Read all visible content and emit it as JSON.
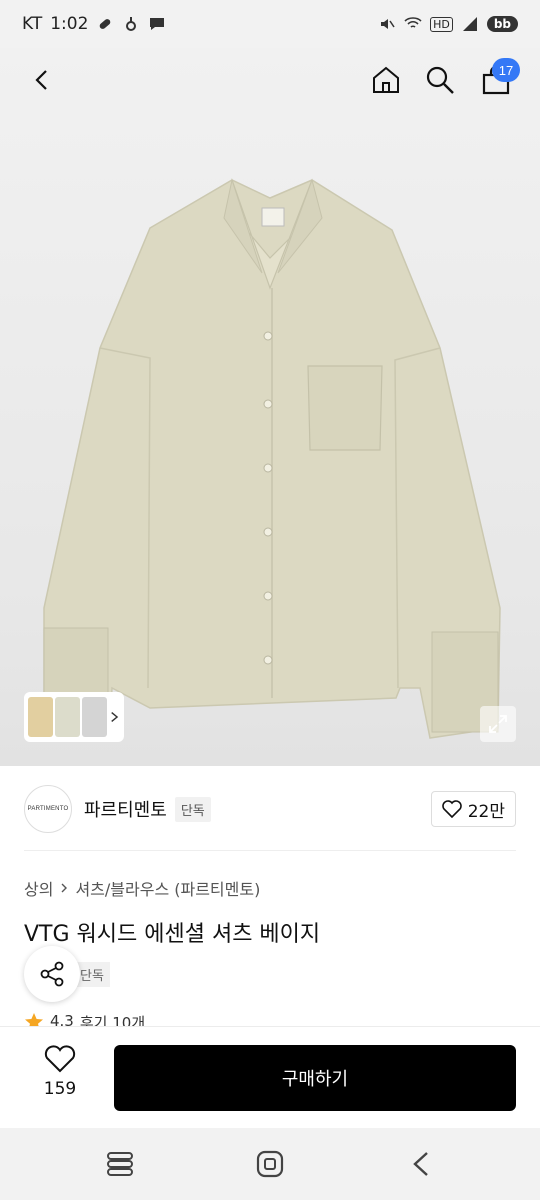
{
  "status_bar": {
    "carrier": "KT",
    "time": "1:02",
    "hd_label": "HD",
    "app_pill": "bb"
  },
  "nav": {
    "cart_count": "17",
    "icons": [
      "back-icon",
      "home-icon",
      "search-icon",
      "cart-icon"
    ]
  },
  "brand": {
    "logo_text": "PARTIMENTO",
    "name": "파르티멘토",
    "exclusive_tag": "단독",
    "like_count": "22만"
  },
  "product": {
    "breadcrumb": [
      "상의",
      "셔츠/블라우스 (파르티멘토)"
    ],
    "title": "VTG 워시드 에센셜 셔츠 베이지",
    "tag": "단독",
    "rating": "4.3",
    "reviews": "후기 10개"
  },
  "bottom_bar": {
    "wish_count": "159",
    "buy_label": "구매하기"
  },
  "colors": {
    "accent": "#3478f6",
    "buy_button": "#000000",
    "shirt": "#dcd9c2",
    "star": "#f5a623"
  }
}
